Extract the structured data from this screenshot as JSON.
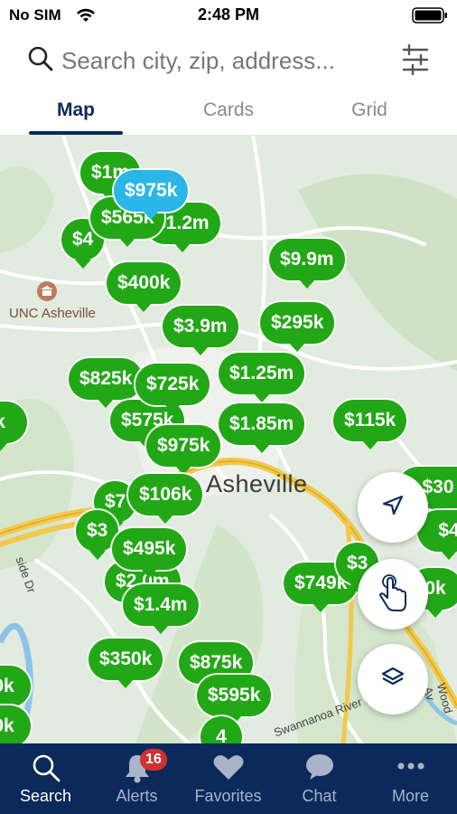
{
  "status": {
    "carrier": "No SIM",
    "time": "2:48 PM"
  },
  "search": {
    "placeholder": "Search city, zip, address..."
  },
  "tabs": [
    {
      "label": "Map",
      "active": true
    },
    {
      "label": "Cards",
      "active": false
    },
    {
      "label": "Grid",
      "active": false
    }
  ],
  "map": {
    "city_label": "Asheville",
    "poi_label": "UNC Asheville",
    "roads": [
      "side Dr",
      "Swannanoa River Rd",
      "Wood Av"
    ],
    "pins": [
      {
        "label": "$1m"
      },
      {
        "label": "$4"
      },
      {
        "label": "$1.2m"
      },
      {
        "label": "$565k"
      },
      {
        "label": "$975k",
        "selected": true
      },
      {
        "label": "$400k"
      },
      {
        "label": "$9.9m"
      },
      {
        "label": "$3.9m"
      },
      {
        "label": "$295k"
      },
      {
        "label": "$825k"
      },
      {
        "label": "$725k"
      },
      {
        "label": "$1.25m"
      },
      {
        "label": "$575k"
      },
      {
        "label": "$1.85m"
      },
      {
        "label": "$115k"
      },
      {
        "label": "$975k"
      },
      {
        "label": "$7"
      },
      {
        "label": "$106k"
      },
      {
        "label": "$3"
      },
      {
        "label": "$495k"
      },
      {
        "label": "$2.0m"
      },
      {
        "label": "$1.4m"
      },
      {
        "label": "$749k"
      },
      {
        "label": "$3"
      },
      {
        "label": "$30"
      },
      {
        "label": "$4"
      },
      {
        "label": "0k"
      },
      {
        "label": "$350k"
      },
      {
        "label": "$875k"
      },
      {
        "label": "$595k"
      },
      {
        "label": "4"
      },
      {
        "label": "k"
      },
      {
        "label": "0k"
      },
      {
        "label": "0k"
      }
    ]
  },
  "controls": {
    "locate": "location-arrow-icon",
    "draw": "hand-pointer-icon",
    "layers": "layers-icon"
  },
  "nav": [
    {
      "label": "Search",
      "icon": "search-icon",
      "active": true
    },
    {
      "label": "Alerts",
      "icon": "bell-icon",
      "badge": "16"
    },
    {
      "label": "Favorites",
      "icon": "heart-icon"
    },
    {
      "label": "Chat",
      "icon": "chat-icon"
    },
    {
      "label": "More",
      "icon": "more-icon"
    }
  ],
  "colors": {
    "pin_green": "#22a816",
    "pin_selected": "#2bb6e8",
    "nav_bg": "#0b2a5b",
    "badge": "#d32f2f"
  }
}
